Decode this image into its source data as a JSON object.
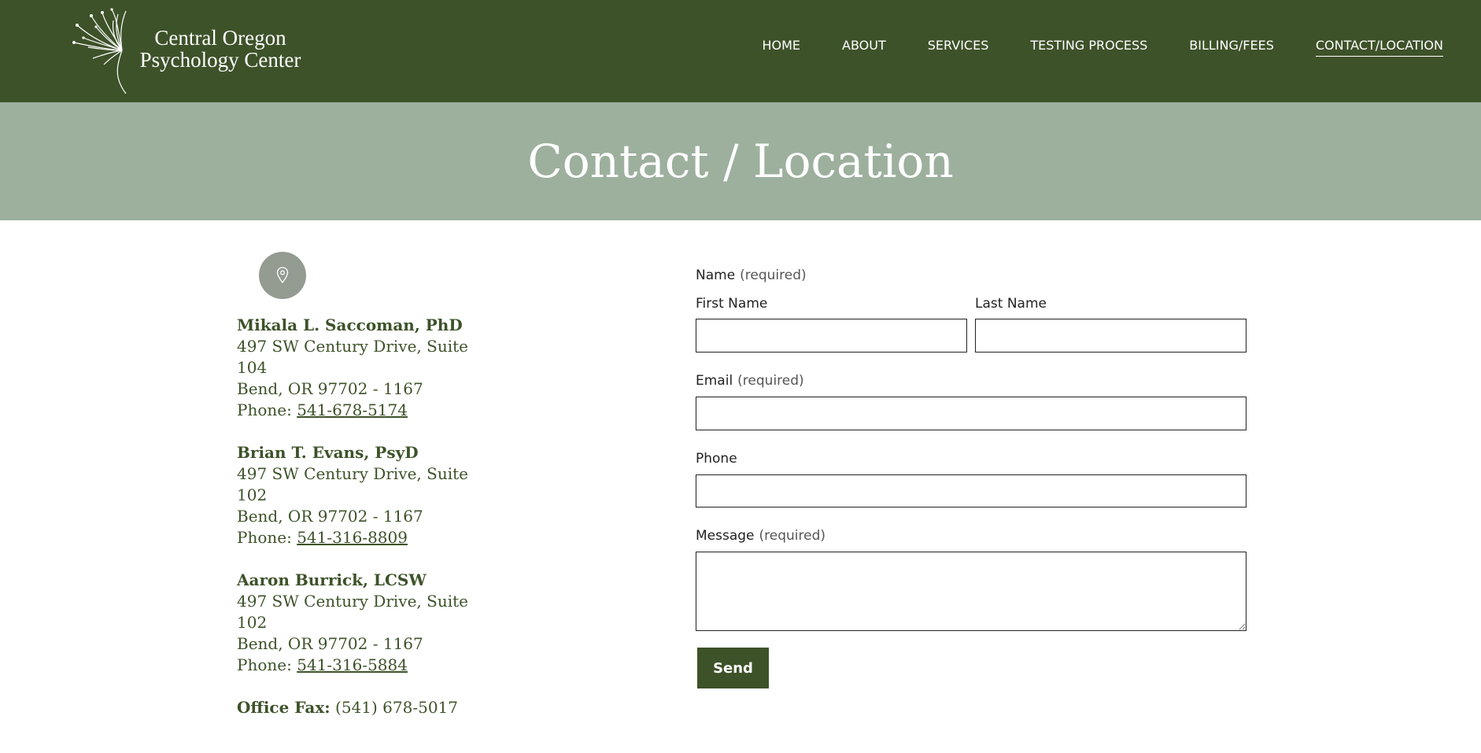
{
  "header": {
    "logo_line1": "Central Oregon",
    "logo_line2": "Psychology Center",
    "nav": [
      {
        "label": "HOME"
      },
      {
        "label": "ABOUT"
      },
      {
        "label": "SERVICES"
      },
      {
        "label": "TESTING PROCESS"
      },
      {
        "label": "BILLING/FEES"
      },
      {
        "label": "CONTACT/LOCATION",
        "active": true
      }
    ]
  },
  "banner": {
    "title": "Contact / Location"
  },
  "contacts": [
    {
      "name": "Mikala L. Saccoman, PhD",
      "address1": "497 SW Century Drive, Suite",
      "address2": "104",
      "city": "Bend, OR 97702 - 1167",
      "phone_label": "Phone: ",
      "phone": "541-678-5174"
    },
    {
      "name": "Brian T. Evans, PsyD",
      "address1": "497 SW Century Drive, Suite",
      "address2": "102",
      "city": "Bend, OR 97702 - 1167",
      "phone_label": "Phone: ",
      "phone": "541-316-8809"
    },
    {
      "name": "Aaron Burrick, LCSW",
      "address1": "497 SW Century Drive, Suite",
      "address2": "102",
      "city": "Bend, OR 97702 - 1167",
      "phone_label": "Phone: ",
      "phone": "541-316-5884"
    }
  ],
  "fax": {
    "label": "Office Fax:",
    "value": " (541) 678-5017"
  },
  "form": {
    "name_label": "Name",
    "required": "(required)",
    "first_name_label": "First Name",
    "first_name_value": "",
    "last_name_label": "Last Name",
    "last_name_value": "",
    "email_label": "Email",
    "email_value": "",
    "phone_label": "Phone",
    "phone_value": "",
    "message_label": "Message",
    "message_value": "",
    "send_label": "Send"
  },
  "colors": {
    "header_bg": "#3d5229",
    "banner_bg": "#9db09e",
    "accent_text": "#3d5229",
    "pin_circle": "#949b91"
  },
  "icons": {
    "location": "map-pin-icon",
    "logo": "dandelion-logo-icon"
  }
}
